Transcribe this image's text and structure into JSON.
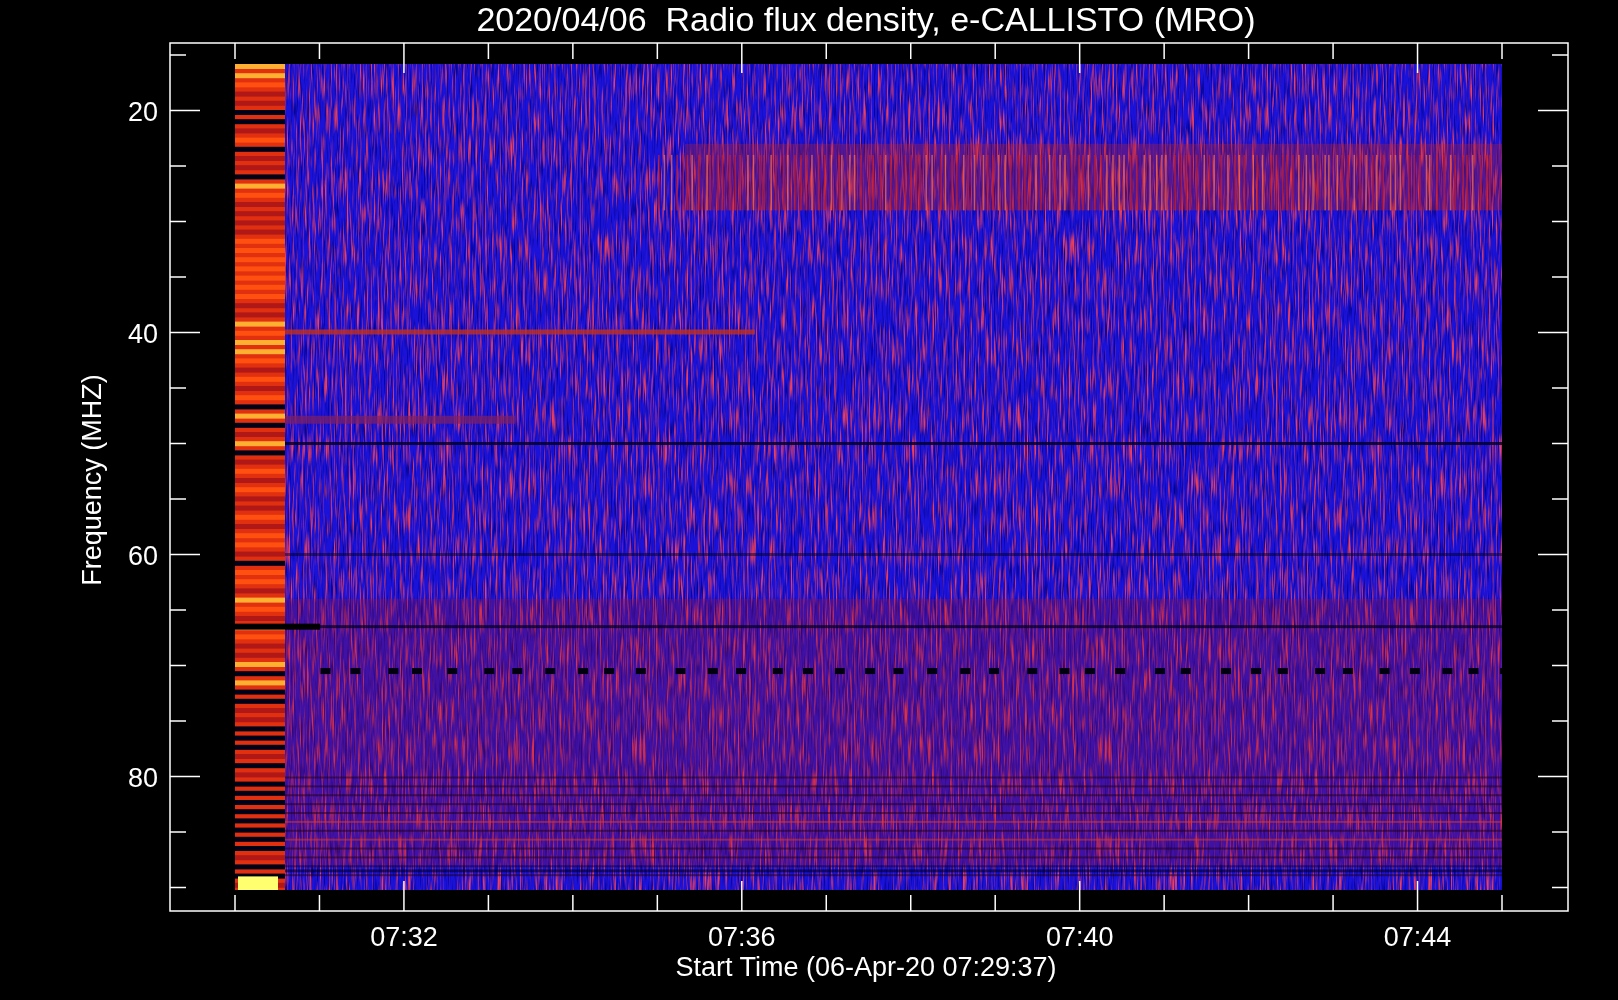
{
  "title": "2020/04/06  Radio flux density, e-CALLISTO (MRO)",
  "y_axis": {
    "label": "Frequency (MHZ)",
    "ticks": [
      "20",
      "40",
      "60",
      "80"
    ]
  },
  "x_axis": {
    "label": "Start Time (06-Apr-20 07:29:37)",
    "ticks": [
      "07:32",
      "07:36",
      "07:40",
      "07:44"
    ]
  }
}
